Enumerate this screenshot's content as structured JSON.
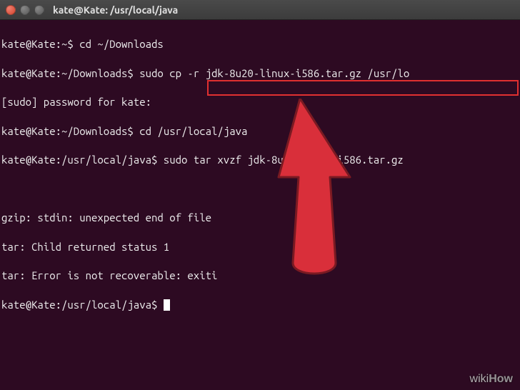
{
  "window": {
    "title": "kate@Kate: /usr/local/java"
  },
  "lines": {
    "l0_prompt": "kate@Kate:~$",
    "l0_cmd": " cd ~/Downloads",
    "l1_prompt": "kate@Kate:~/Downloads$",
    "l1_cmd": " sudo cp -r jdk-8u20-linux-i586.tar.gz /usr/lo",
    "l2": "[sudo] password for kate:",
    "l3_prompt": "kate@Kate:~/Downloads$",
    "l3_cmd": " cd /usr/local/java",
    "l4_prompt": "kate@Kate:/usr/local/java$",
    "l4_cmd": " sudo tar xvzf jdk-8u20-linux-i586.tar.gz",
    "l5": " ",
    "l6": "gzip: stdin: unexpected end of file",
    "l7": "tar: Child returned status 1",
    "l8": "tar: Error is not recoverable: exiti",
    "l9_prompt": "kate@Kate:/usr/local/java$",
    "l9_cmd": " "
  },
  "watermark": {
    "w1": "wiki",
    "w2": "How"
  }
}
